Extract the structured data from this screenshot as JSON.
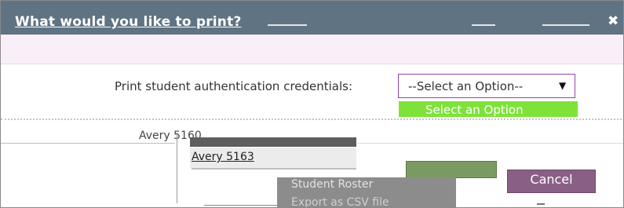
{
  "dialog": {
    "title": "What would you like to print?",
    "close_glyph": "✖"
  },
  "form": {
    "prompt_label": "Print student authentication credentials:",
    "select": {
      "selected_label": "--Select an Option--",
      "caret_glyph": "▼"
    },
    "options": {
      "select_option": "Select an Option",
      "avery_5160": "Avery 5160",
      "avery_5163": "Avery 5163",
      "student_roster": "Student Roster",
      "export_csv": "Export as CSV file"
    }
  },
  "buttons": {
    "print_label": "",
    "cancel_label": "Cancel"
  },
  "colors": {
    "titlebar": "#5f7383",
    "band": "#f9eff9",
    "select_border": "#8e44ad",
    "option_highlight": "#7ee23a",
    "print_button": "#7b9a62",
    "cancel_button": "#8a5f85",
    "roster_option": "#8c8c8c"
  }
}
